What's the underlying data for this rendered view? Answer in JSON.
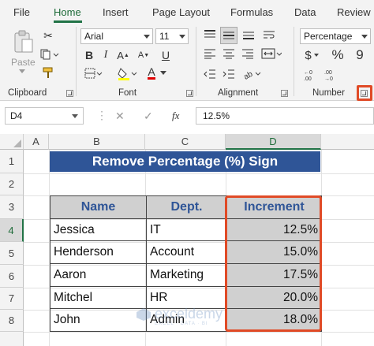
{
  "ribbon_tabs": [
    "File",
    "Home",
    "Insert",
    "Page Layout",
    "Formulas",
    "Data",
    "Review"
  ],
  "active_tab": "Home",
  "clipboard": {
    "paste_label": "Paste",
    "group_label": "Clipboard"
  },
  "font": {
    "family": "Arial",
    "size": "11",
    "group_label": "Font",
    "bold": "B",
    "italic": "I",
    "underline": "U",
    "font_color_glyph": "A"
  },
  "alignment": {
    "group_label": "Alignment"
  },
  "number": {
    "format": "Percentage",
    "group_label": "Number",
    "currency": "$",
    "percent": "%",
    "comma": "9"
  },
  "formula_bar": {
    "name_box": "D4",
    "cancel": "✕",
    "enter": "✓",
    "fx": "fx",
    "value": "12.5%"
  },
  "columns": [
    "A",
    "B",
    "C",
    "D"
  ],
  "selected_column": "D",
  "rows": [
    "1",
    "2",
    "3",
    "4",
    "5",
    "6",
    "7",
    "8"
  ],
  "selected_row": "4",
  "sheet": {
    "title": "Remove Percentage (%) Sign",
    "headers": [
      "Name",
      "Dept.",
      "Increment"
    ],
    "records": [
      {
        "name": "Jessica",
        "dept": "IT",
        "increment": "12.5%"
      },
      {
        "name": "Henderson",
        "dept": "Account",
        "increment": "15.0%"
      },
      {
        "name": "Aaron",
        "dept": "Marketing",
        "increment": "17.5%"
      },
      {
        "name": "Mitchel",
        "dept": "HR",
        "increment": "20.0%"
      },
      {
        "name": "John",
        "dept": "Admin",
        "increment": "18.0%"
      }
    ]
  },
  "watermark": {
    "name": "exceldemy",
    "tagline": "EXCEL · DATA · BI"
  },
  "colors": {
    "excel_green": "#217346",
    "title_fill": "#2f5597",
    "highlight_red": "#e04a26",
    "cell_gray": "#d0d0d0"
  }
}
